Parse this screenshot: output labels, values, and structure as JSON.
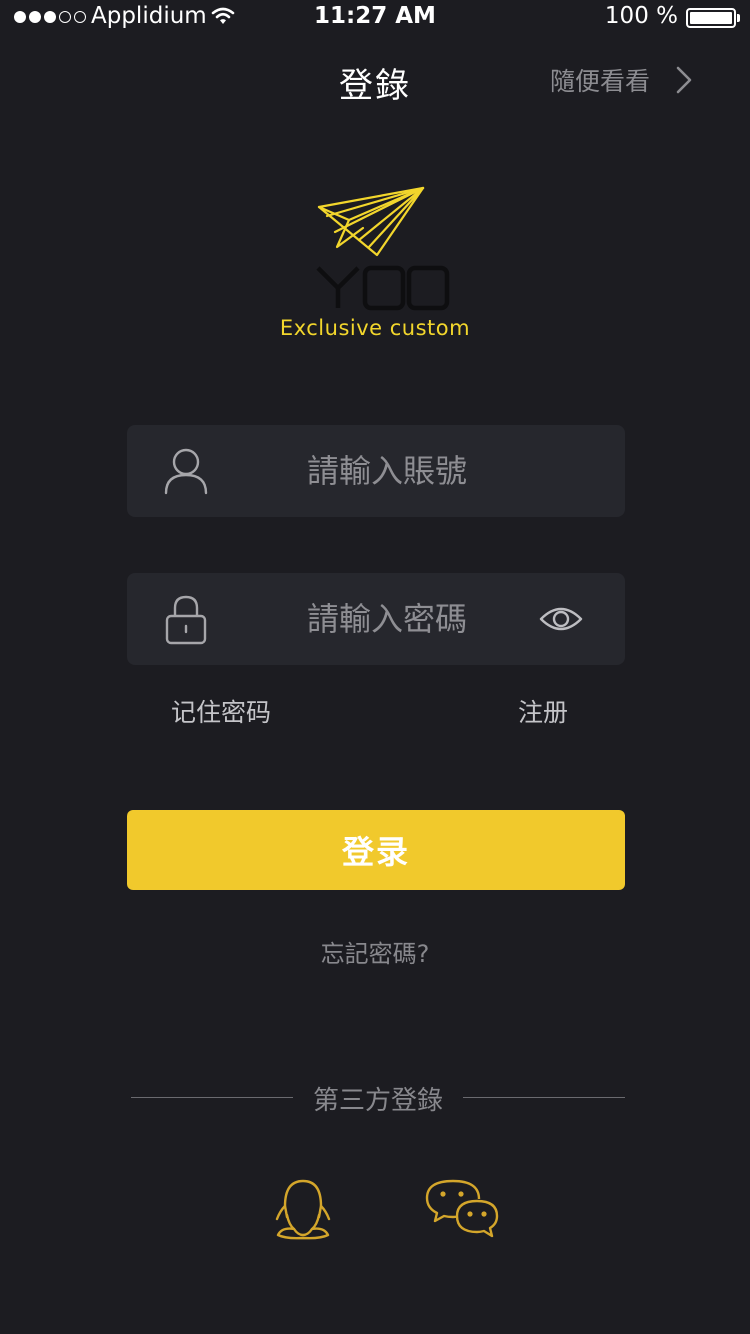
{
  "status_bar": {
    "carrier": "Applidium",
    "time": "11:27 AM",
    "battery": "100 %"
  },
  "nav": {
    "title": "登錄",
    "skip_label": "隨便看看"
  },
  "logo": {
    "brand": "YOO",
    "tagline": "Exclusive custom"
  },
  "form": {
    "account_placeholder": "請輸入賬號",
    "password_placeholder": "請輸入密碼",
    "remember_label": "记住密码",
    "register_label": "注册",
    "login_label": "登录",
    "forgot_label": "忘記密碼?"
  },
  "third_party": {
    "label": "第三方登錄",
    "providers": [
      "qq-icon",
      "wechat-icon"
    ]
  },
  "colors": {
    "background": "#1c1c21",
    "field": "#26272d",
    "accent": "#f1c92c"
  }
}
